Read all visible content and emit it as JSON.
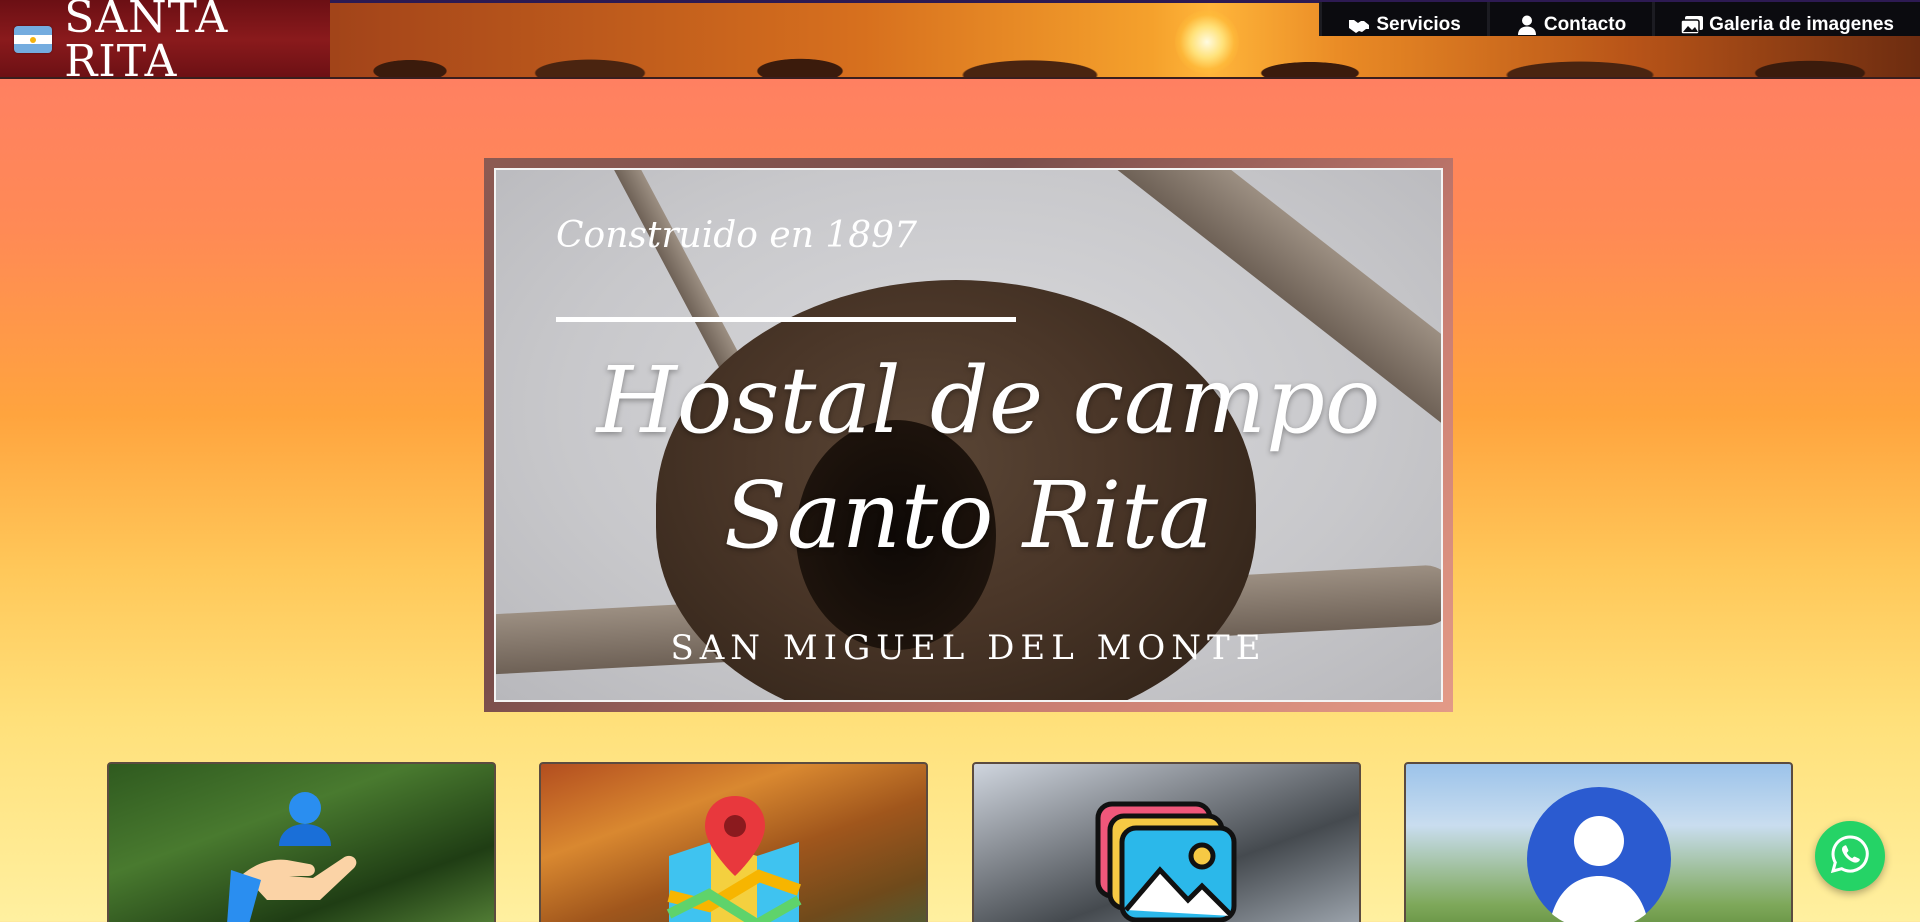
{
  "navbar": {
    "brand_title": "SANTA RITA",
    "flag_icon": "argentina-flag-icon",
    "menu": [
      {
        "label": "Servicios",
        "icon": "handshake-icon"
      },
      {
        "label": "Contacto",
        "icon": "user-icon"
      },
      {
        "label": "Galeria de imagenes",
        "icon": "images-icon"
      }
    ]
  },
  "hero": {
    "small_text": "Construido en 1897",
    "title_line1": "Hostal de campo",
    "title_line2": "Santo Rita",
    "subtitle": "SAN MIGUEL DEL MONTE"
  },
  "cards": [
    {
      "icon": "hand-holding-user-icon"
    },
    {
      "icon": "map-pin-icon"
    },
    {
      "icon": "gallery-icon"
    },
    {
      "icon": "user-profile-icon"
    }
  ],
  "whatsapp": {
    "icon": "whatsapp-icon"
  },
  "colors": {
    "accent_green": "#25d366",
    "nav_dark": "#0b0b0f",
    "brand_red": "#8a1a1c"
  }
}
